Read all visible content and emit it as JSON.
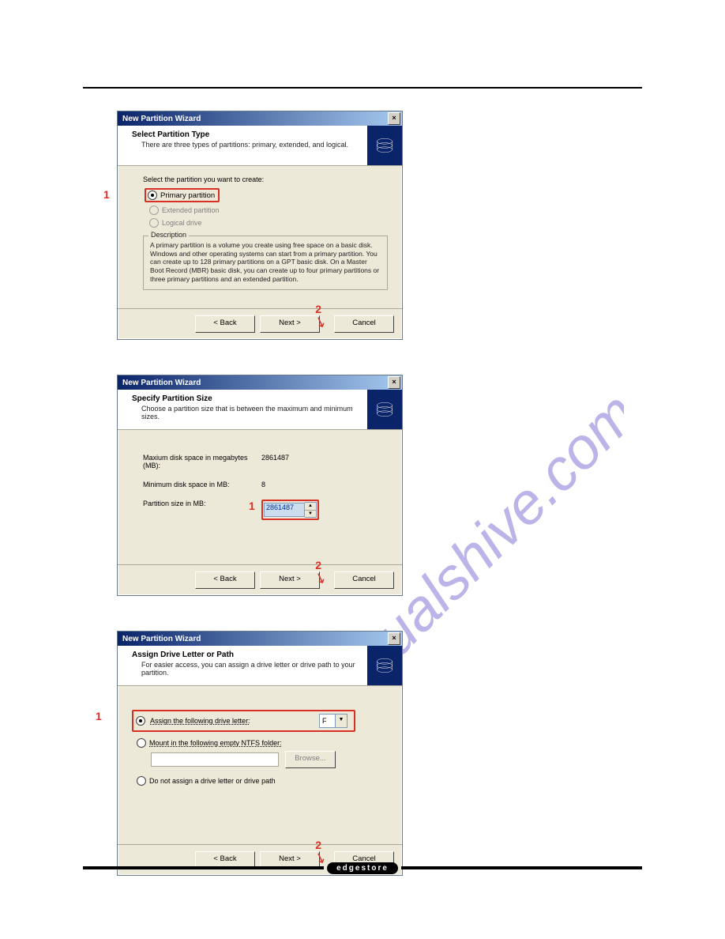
{
  "watermark": "manualshive.com",
  "footer_logo": "edgestore",
  "dialog1": {
    "title": "New Partition Wizard",
    "header_title": "Select Partition Type",
    "header_sub": "There are three types of partitions: primary, extended, and logical.",
    "instruction": "Select the partition you want to create:",
    "opt_primary": "Primary partition",
    "opt_extended": "Extended partition",
    "opt_logical": "Logical drive",
    "desc_legend": "Description",
    "desc_text": "A primary partition is a volume you create using free space on a basic disk. Windows and other operating systems can start from a primary partition. You can create up to 128 primary partitions on a GPT basic disk. On a Master Boot Record (MBR) basic disk, you can create up to four primary partitions or three primary partitions and an extended partition.",
    "btn_back": "< Back",
    "btn_next": "Next >",
    "btn_cancel": "Cancel",
    "callout1": "1",
    "callout2": "2"
  },
  "dialog2": {
    "title": "New Partition Wizard",
    "header_title": "Specify Partition Size",
    "header_sub": "Choose a partition size that is between the maximum and minimum sizes.",
    "row_max_label": "Maxium disk space in megabytes (MB):",
    "row_max_value": "2861487",
    "row_min_label": "Minimum disk space in MB:",
    "row_min_value": "8",
    "row_size_label": "Partition size in MB:",
    "row_size_value": "2861487",
    "btn_back": "< Back",
    "btn_next": "Next >",
    "btn_cancel": "Cancel",
    "callout1": "1",
    "callout2": "2"
  },
  "dialog3": {
    "title": "New Partition Wizard",
    "header_title": "Assign Drive Letter or Path",
    "header_sub": "For easier access, you can assign a drive letter or drive path to your partition.",
    "opt_assign": "Assign the following drive letter:",
    "drive_value": "F",
    "opt_mount": "Mount in the following empty NTFS folder:",
    "btn_browse": "Browse...",
    "opt_none": "Do not assign a drive letter or drive path",
    "btn_back": "< Back",
    "btn_next": "Next >",
    "btn_cancel": "Cancel",
    "callout1": "1",
    "callout2": "2"
  }
}
